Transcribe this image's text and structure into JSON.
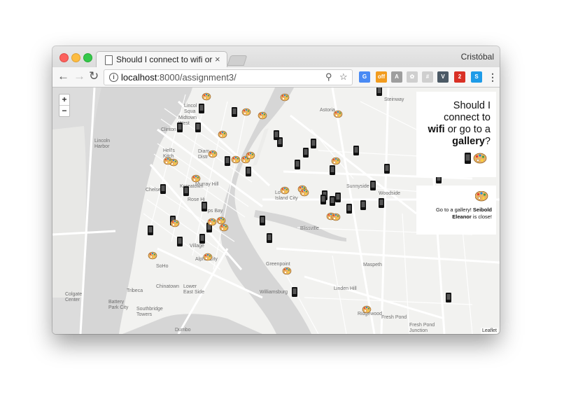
{
  "browser": {
    "tab_title": "Should I connect to wifi or go to a gallery?",
    "tab_close": "×",
    "profile_name": "Cristóbal",
    "url_host": "localhost",
    "url_path": ":8000/assignment3/",
    "extensions": [
      {
        "name": "translate-extension-icon",
        "color": "#4a8af4",
        "label": "G"
      },
      {
        "name": "coupon-extension-icon",
        "color": "#f29c1f",
        "label": "off"
      },
      {
        "name": "reader-extension-icon",
        "color": "#9e9e9e",
        "label": "A"
      },
      {
        "name": "gear-extension-icon",
        "color": "#cfcfcf",
        "label": "✿"
      },
      {
        "name": "grid-extension-icon",
        "color": "#cfcfcf",
        "label": "#"
      },
      {
        "name": "vue-extension-icon",
        "color": "#4c5a66",
        "label": "V"
      },
      {
        "name": "block-extension-icon",
        "color": "#d93025",
        "label": "2"
      },
      {
        "name": "skype-extension-icon",
        "color": "#1e9be8",
        "label": "S"
      }
    ]
  },
  "map": {
    "zoom_in": "+",
    "zoom_out": "−",
    "attribution": "Leaflet",
    "labels": [
      {
        "text": "Lincoln Square",
        "lines": [
          "Lincol",
          "Squa"
        ]
      },
      {
        "text": "Midtown West",
        "lines": [
          "Midtown",
          "West"
        ]
      },
      {
        "text": "Clinton",
        "lines": [
          "Clinton"
        ]
      },
      {
        "text": "Lincoln Harbor",
        "lines": [
          "Lincoln",
          "Harbor"
        ]
      },
      {
        "text": "Hell's Kitchen",
        "lines": [
          "Hell's",
          "Kitch"
        ]
      },
      {
        "text": "Diamond District",
        "lines": [
          "Diam",
          "Distr"
        ]
      },
      {
        "text": "Chelsea",
        "lines": [
          "Chelse"
        ]
      },
      {
        "text": "Koreatown",
        "lines": [
          "Koreatown"
        ]
      },
      {
        "text": "Murray Hill",
        "lines": [
          "Murray Hill"
        ]
      },
      {
        "text": "Rose Hill",
        "lines": [
          "Rose Hi"
        ]
      },
      {
        "text": "Kips Bay",
        "lines": [
          "ps Bay"
        ]
      },
      {
        "text": "Village",
        "lines": [
          "Village"
        ]
      },
      {
        "text": "SoHo",
        "lines": [
          "SoHo"
        ]
      },
      {
        "text": "Alphabet City",
        "lines": [
          "Alpha   City"
        ]
      },
      {
        "text": "Colgate Center",
        "lines": [
          "Colgate",
          "Center"
        ]
      },
      {
        "text": "Tribeca",
        "lines": [
          "Tribeca"
        ]
      },
      {
        "text": "Chinatown",
        "lines": [
          "Chinatown"
        ]
      },
      {
        "text": "Lower East Side",
        "lines": [
          "Lower",
          "East Side"
        ]
      },
      {
        "text": "Battery Park City",
        "lines": [
          "Battery",
          "Park City"
        ]
      },
      {
        "text": "Southbridge Towers",
        "lines": [
          "Southbridge",
          "Towers"
        ]
      },
      {
        "text": "Dumbo",
        "lines": [
          "Dumbo"
        ]
      },
      {
        "text": "Steinway",
        "lines": [
          "Steinway"
        ]
      },
      {
        "text": "Astoria",
        "lines": [
          "Astoria"
        ]
      },
      {
        "text": "Long Island City",
        "lines": [
          "Lo",
          "Island City"
        ]
      },
      {
        "text": "Sunnyside",
        "lines": [
          "Sunnyside"
        ]
      },
      {
        "text": "Woodside",
        "lines": [
          "Woodside"
        ]
      },
      {
        "text": "Blissville",
        "lines": [
          "Blissville"
        ]
      },
      {
        "text": "Greenpoint",
        "lines": [
          "Greenpoint"
        ]
      },
      {
        "text": "Maspeth",
        "lines": [
          "Maspeth"
        ]
      },
      {
        "text": "Williamsburg",
        "lines": [
          "Williamsburg"
        ]
      },
      {
        "text": "Linden Hill",
        "lines": [
          "Linden Hill"
        ]
      },
      {
        "text": "Ridgewood",
        "lines": [
          "Ridgewood"
        ]
      },
      {
        "text": "Fresh Pond",
        "lines": [
          "Fresh Pond"
        ]
      },
      {
        "text": "Fresh Pond Junction",
        "lines": [
          "Fresh Pond",
          "Junction"
        ]
      }
    ],
    "wifi_marker_count": 36,
    "gallery_marker_count": 27
  },
  "panel": {
    "title_line1": "Should I",
    "title_line2": "connect to",
    "title_bold1": "wifi",
    "title_line3_rest": " or go to a",
    "title_bold2": "gallery",
    "title_end": "?",
    "message_prefix": "Go to a gallery! ",
    "message_name": "Seibold Eleanor",
    "message_suffix": " is close!"
  }
}
